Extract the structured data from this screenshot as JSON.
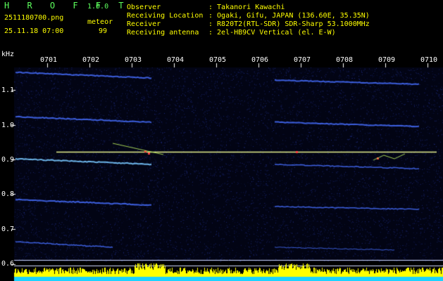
{
  "header": {
    "app_title": "H R O F F T",
    "version": "1.0.0",
    "filename": "2511180700.png",
    "datetime": "25.11.18 07:00",
    "mode_label": "meteor",
    "meteor_count": "99",
    "info_labels": [
      "Observer",
      "Receiving Location",
      "Receiver",
      "Receiving antenna"
    ],
    "info_values": [
      ": Takanori Kawachi",
      ": Ogaki, Gifu, JAPAN (136.60E, 35.35N)",
      ": R820T2(RTL-SDR) SDR-Sharp 53.1000MHz",
      ": 2el-HB9CV Vertical (el. E-W)"
    ]
  },
  "axes": {
    "y_unit": "kHz",
    "y_ticks": [
      "1.1",
      "1.0",
      "0.9",
      "0.8",
      "0.7",
      "0.6"
    ],
    "x_ticks": [
      "0701",
      "0702",
      "0703",
      "0704",
      "0705",
      "0706",
      "0707",
      "0708",
      "0709",
      "0710"
    ]
  },
  "colors": {
    "background": "#000000",
    "title_green": "#5dff5d",
    "header_yellow": "#ffff00",
    "carrier_line": "#e6f08c",
    "echo_blue": "#3c5aff",
    "noise_bar_yellow": "#ffff00",
    "noise_bar_cyan": "#19d2ff"
  }
}
